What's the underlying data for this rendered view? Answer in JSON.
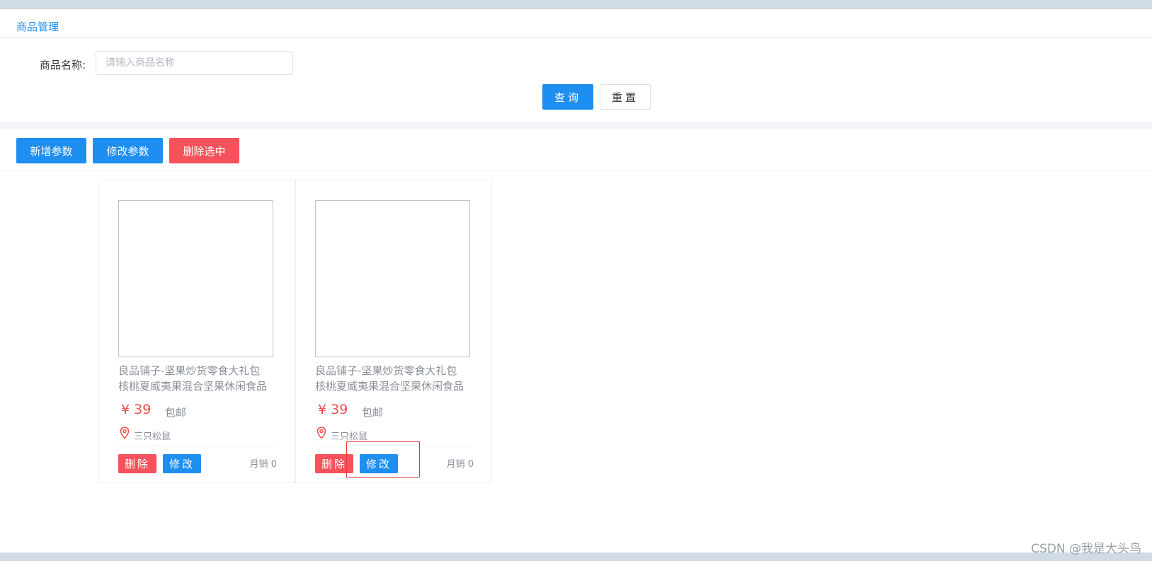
{
  "tabs": [
    {
      "label": "商品管理"
    }
  ],
  "search": {
    "label": "商品名称:",
    "placeholder": "请输入商品名称",
    "value": "",
    "query_label": "查询",
    "reset_label": "重置"
  },
  "toolbar": {
    "add_label": "新增参数",
    "edit_label": "修改参数",
    "delete_selected_label": "删除选中"
  },
  "products": [
    {
      "title_line1": "良品铺子-坚果炒货零食大礼包",
      "title_line2": "核桃夏威夷果混合坚果休闲食品",
      "price": "¥ 39",
      "shipping": "包邮",
      "store": "三只松鼠",
      "delete_label": "删除",
      "edit_label": "修改",
      "sales": "月销 0"
    },
    {
      "title_line1": "良品铺子-坚果炒货零食大礼包",
      "title_line2": "核桃夏威夷果混合坚果休闲食品",
      "price": "¥ 39",
      "shipping": "包邮",
      "store": "三只松鼠",
      "delete_label": "删除",
      "edit_label": "修改",
      "sales": "月销 0"
    }
  ],
  "watermark": "CSDN @我是大头鸟",
  "colors": {
    "primary": "#1e8ef0",
    "danger": "#f5525b",
    "price": "#f04b4b",
    "highlight_box": "#e53935"
  },
  "icons": {
    "location": "location-pin-icon"
  }
}
